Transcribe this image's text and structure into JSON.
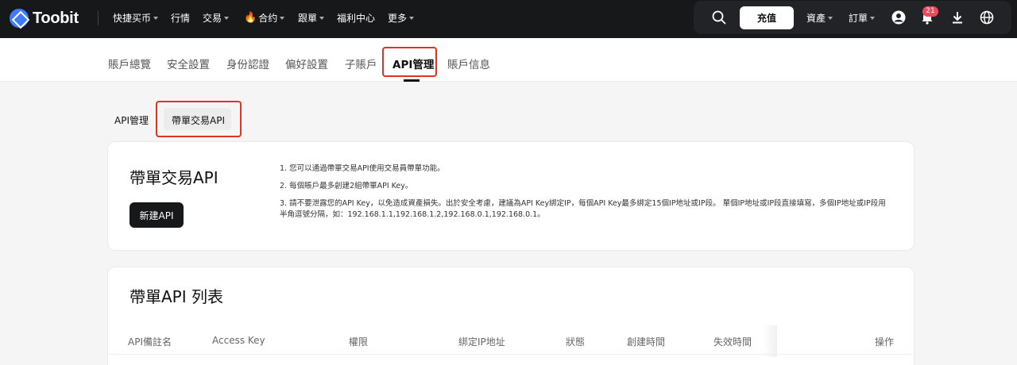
{
  "brand": {
    "name": "Toobit"
  },
  "topnav": {
    "items": [
      {
        "label": "快捷买币",
        "has_caret": true
      },
      {
        "label": "行情",
        "has_caret": false
      },
      {
        "label": "交易",
        "has_caret": true
      },
      {
        "label": "合约",
        "has_caret": true,
        "icon": "fire-icon"
      },
      {
        "label": "跟單",
        "has_caret": true
      },
      {
        "label": "福利中心",
        "has_caret": false
      },
      {
        "label": "更多",
        "has_caret": true
      }
    ],
    "deposit_label": "充值",
    "assets_label": "資產",
    "orders_label": "訂單",
    "notification_count": "21",
    "icons": [
      "search-icon",
      "user-icon",
      "bell-icon",
      "download-icon",
      "globe-icon"
    ]
  },
  "subnav": {
    "tabs": [
      {
        "label": "賬戶總覽"
      },
      {
        "label": "安全設置"
      },
      {
        "label": "身份認證"
      },
      {
        "label": "偏好設置"
      },
      {
        "label": "子賬戶"
      },
      {
        "label": "API管理",
        "active": true
      },
      {
        "label": "賬戶信息"
      }
    ]
  },
  "inner_tabs": [
    {
      "label": "API管理"
    },
    {
      "label": "帶單交易API",
      "active": true
    }
  ],
  "intro_card": {
    "title": "帶單交易API",
    "button_label": "新建API",
    "notes": [
      "1. 您可以通過帶單交易API使用交易員帶單功能。",
      "2. 每個賬戶最多創建2組帶單API Key。",
      "3. 請不要泄露您的API Key，以免造成資產損失。出於安全考慮，建議為API Key綁定IP，每個API Key最多綁定15個IP地址或IP段。 單個IP地址或IP段直接填寫，多個IP地址或IP段用半角逗號分隔，如：192.168.1.1,192.168.1.2,192.168.0.1,192.168.0.1。"
    ]
  },
  "list_card": {
    "title": "帶單API 列表",
    "columns": [
      "API備註名",
      "Access Key",
      "權限",
      "綁定IP地址",
      "狀態",
      "創建時間",
      "失效時間",
      "操作"
    ]
  },
  "colors": {
    "highlight": "#e0341e",
    "nav_bg": "#17181a",
    "badge": "#f6465d"
  }
}
